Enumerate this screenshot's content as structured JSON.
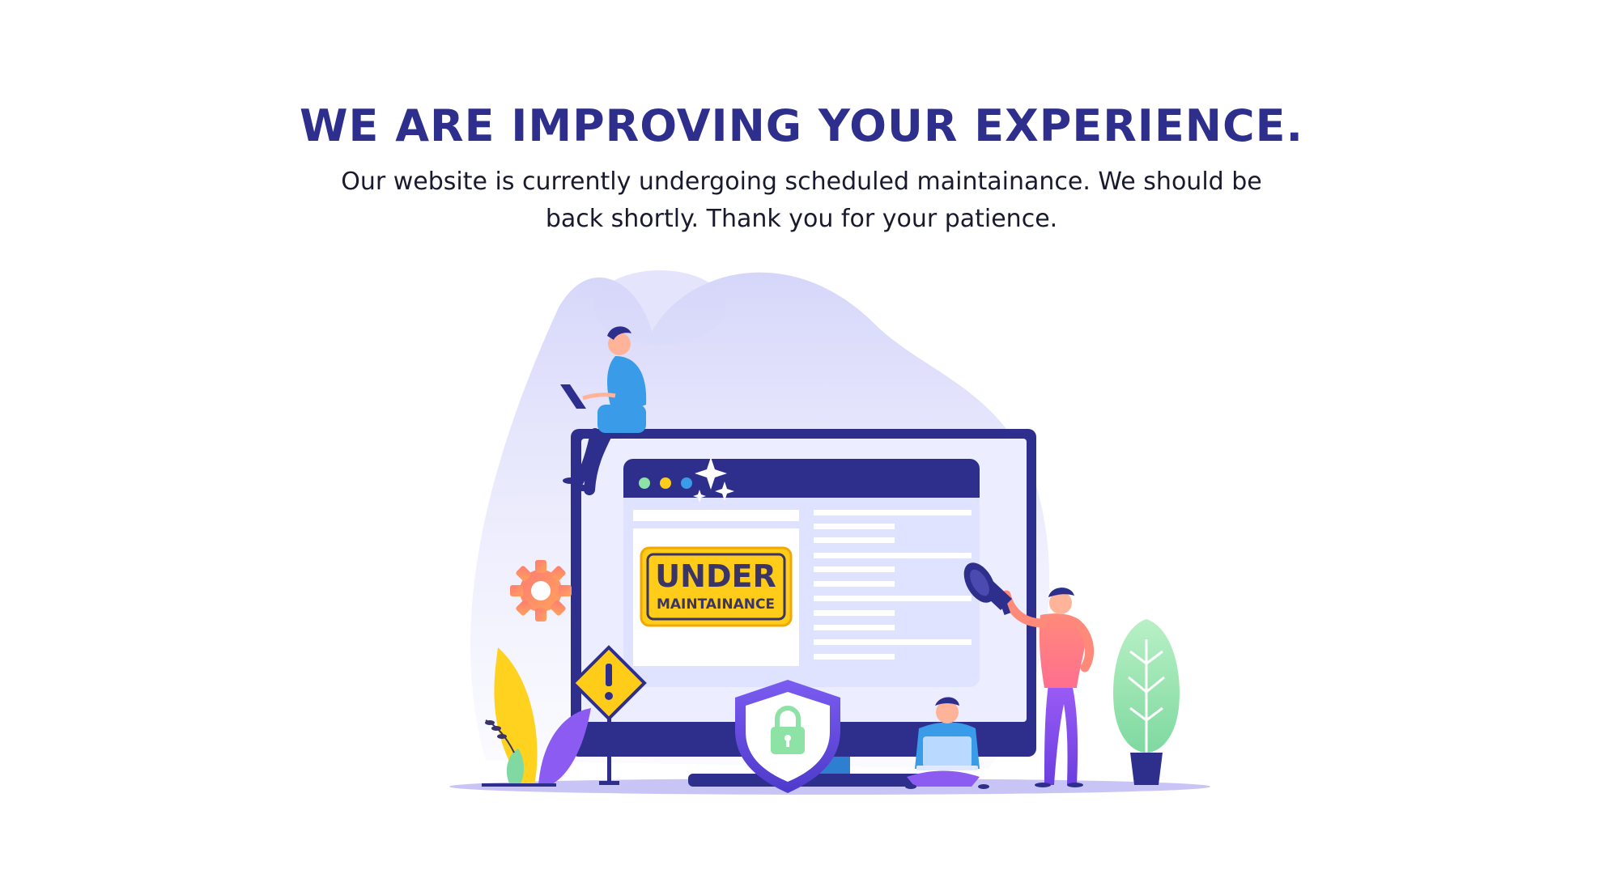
{
  "headline": "WE ARE IMPROVING YOUR EXPERIENCE.",
  "message": "Our website is currently undergoing scheduled maintainance. We should be back shortly. Thank you for your patience.",
  "sign": {
    "line1": "UNDER",
    "line2": "MAINTAINANCE"
  },
  "colors": {
    "brand": "#2e2f8c",
    "accent_yellow": "#ffcc1a",
    "blob": "#dcdcfb",
    "screen": "#eef0ff"
  },
  "icons": [
    "gear-icon",
    "warning-sign-icon",
    "padlock-shield-icon",
    "megaphone-icon",
    "sparkle-icon"
  ]
}
